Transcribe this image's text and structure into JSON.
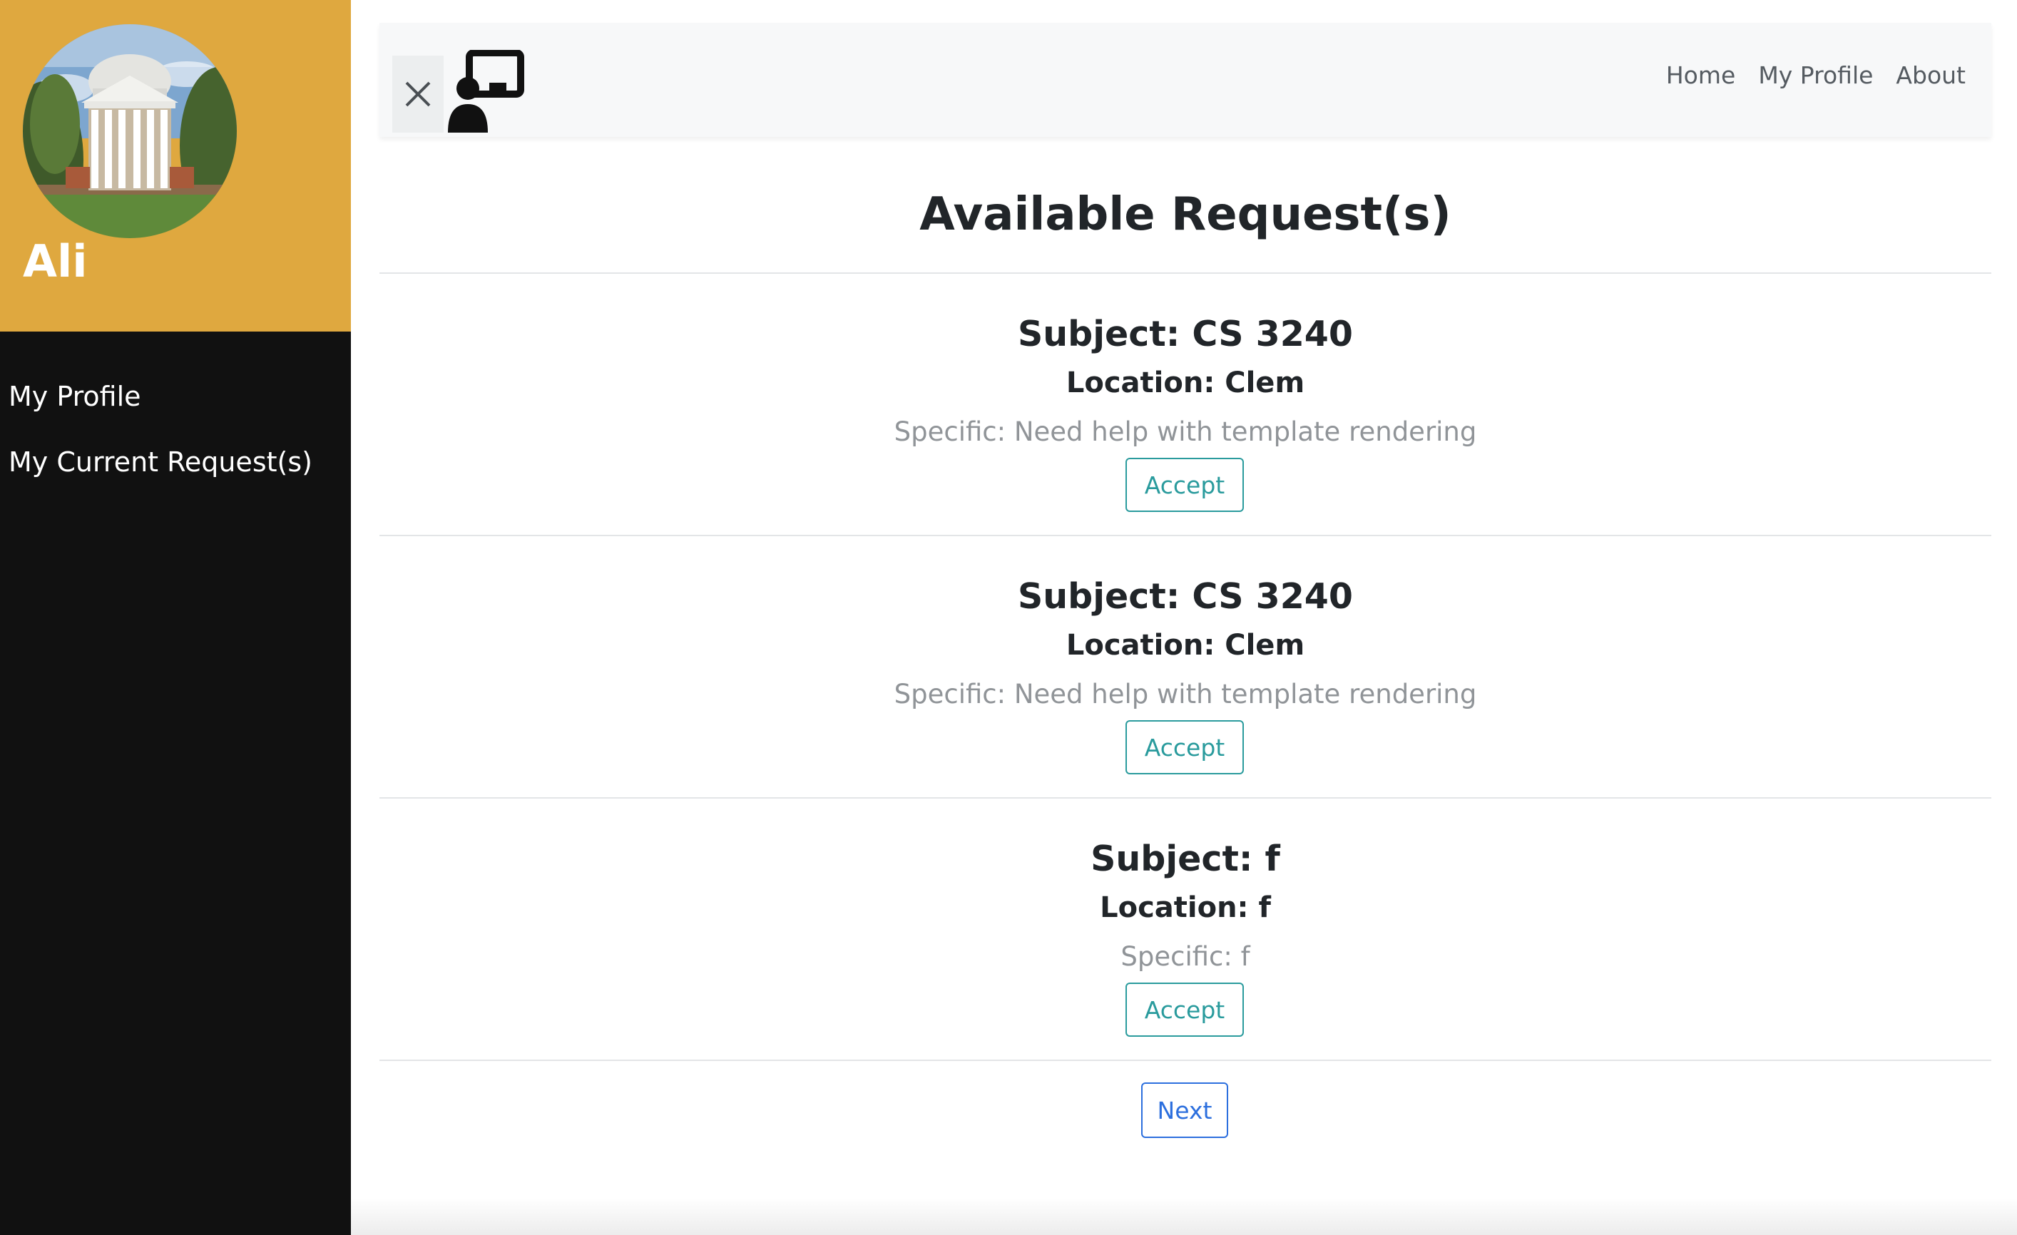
{
  "user": {
    "name": "Ali"
  },
  "sidebar": {
    "items": [
      {
        "label": "My Profile"
      },
      {
        "label": "My Current Request(s)"
      }
    ]
  },
  "topnav": {
    "items": [
      {
        "label": "Home"
      },
      {
        "label": "My Profile"
      },
      {
        "label": "About"
      }
    ]
  },
  "icons": {
    "close": "close-icon",
    "logo": "tutor-presentation-icon"
  },
  "main": {
    "title": "Available Request(s)",
    "requests": [
      {
        "subject": "Subject: CS 3240",
        "location": "Location: Clem",
        "specific": "Specific: Need help with template rendering",
        "action": "Accept"
      },
      {
        "subject": "Subject: CS 3240",
        "location": "Location: Clem",
        "specific": "Specific: Need help with template rendering",
        "action": "Accept"
      },
      {
        "subject": "Subject: f",
        "location": "Location: f",
        "specific": "Specific: f",
        "action": "Accept"
      }
    ],
    "next_label": "Next"
  },
  "colors": {
    "sidebar_header": "#dfa83f",
    "sidebar_bg": "#111111",
    "accept_accent": "#2a9b9d",
    "next_accent": "#2c6fde"
  }
}
